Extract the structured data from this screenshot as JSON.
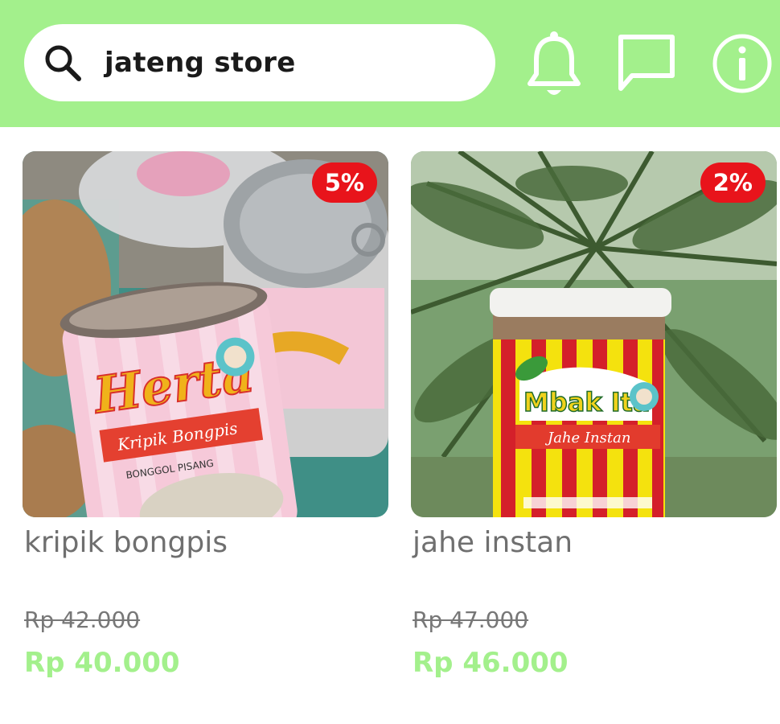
{
  "header": {
    "search": {
      "value": "jateng store",
      "icon": "search-icon"
    },
    "icons": [
      "bell-icon",
      "chat-icon",
      "info-icon"
    ],
    "background_color": "#a3f08c"
  },
  "products": [
    {
      "name": "kripik bongpis",
      "discount": "5%",
      "original_price": "Rp 42.000",
      "sale_price": "Rp 40.000",
      "image_labels": {
        "brand": "Herta",
        "subtitle": "Kripik Bongpis",
        "line": "BONGGOL PISANG"
      }
    },
    {
      "name": "jahe instan",
      "discount": "2%",
      "original_price": "Rp 47.000",
      "sale_price": "Rp 46.000",
      "image_labels": {
        "brand": "Mbak Ita",
        "subtitle": "Jahe Instan"
      }
    }
  ],
  "colors": {
    "accent": "#a3f08c",
    "badge": "#e8141b",
    "price": "#a3f08c"
  }
}
